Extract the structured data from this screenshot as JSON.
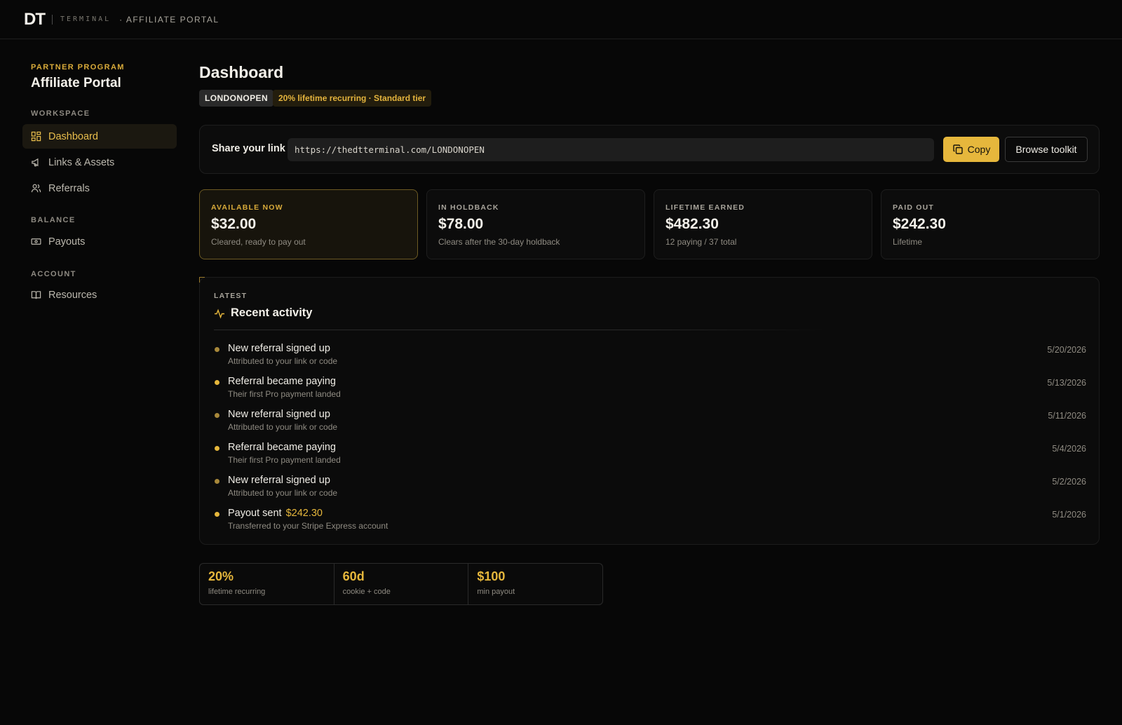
{
  "topbar": {
    "logo": "DT",
    "logo_sub": "TERMINAL",
    "portal": "· AFFILIATE PORTAL"
  },
  "sidebar": {
    "eyebrow": "PARTNER PROGRAM",
    "title": "Affiliate Portal",
    "sections": {
      "workspace": "WORKSPACE",
      "balance": "BALANCE",
      "account": "ACCOUNT"
    },
    "items": {
      "dashboard": "Dashboard",
      "links": "Links & Assets",
      "referrals": "Referrals",
      "payouts": "Payouts",
      "resources": "Resources"
    }
  },
  "page": {
    "title": "Dashboard",
    "code_chip": "LONDONOPEN",
    "tier_chip": "20% lifetime recurring · Standard tier"
  },
  "share": {
    "label": "Share your link",
    "url": "https://thedtterminal.com/LONDONOPEN",
    "copy_label": "Copy",
    "browse_label": "Browse toolkit"
  },
  "stats": [
    {
      "label": "AVAILABLE NOW",
      "value": "$32.00",
      "sub": "Cleared, ready to pay out"
    },
    {
      "label": "IN HOLDBACK",
      "value": "$78.00",
      "sub": "Clears after the 30-day holdback"
    },
    {
      "label": "LIFETIME EARNED",
      "value": "$482.30",
      "sub": "12 paying / 37 total"
    },
    {
      "label": "PAID OUT",
      "value": "$242.30",
      "sub": "Lifetime"
    }
  ],
  "activity": {
    "eyebrow": "LATEST",
    "title": "Recent activity",
    "items": [
      {
        "title": "New referral signed up",
        "amount": "",
        "sub": "Attributed to your link or code",
        "date": "5/20/2026"
      },
      {
        "title": "Referral became paying",
        "amount": "",
        "sub": "Their first Pro payment landed",
        "date": "5/13/2026"
      },
      {
        "title": "New referral signed up",
        "amount": "",
        "sub": "Attributed to your link or code",
        "date": "5/11/2026"
      },
      {
        "title": "Referral became paying",
        "amount": "",
        "sub": "Their first Pro payment landed",
        "date": "5/4/2026"
      },
      {
        "title": "New referral signed up",
        "amount": "",
        "sub": "Attributed to your link or code",
        "date": "5/2/2026"
      },
      {
        "title": "Payout sent",
        "amount": "$242.30",
        "sub": "Transferred to your Stripe Express account",
        "date": "5/1/2026"
      }
    ]
  },
  "terms": [
    {
      "value": "20%",
      "label": "lifetime recurring"
    },
    {
      "value": "60d",
      "label": "cookie + code"
    },
    {
      "value": "$100",
      "label": "min payout"
    }
  ],
  "colors": {
    "accent": "#e6b73c",
    "background": "#070707",
    "card": "#0c0c0c"
  }
}
